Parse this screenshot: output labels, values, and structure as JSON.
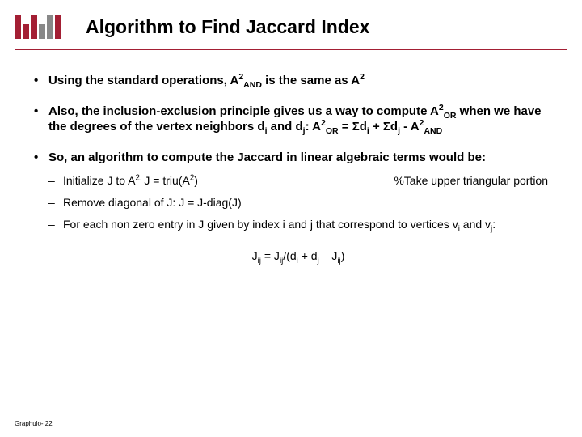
{
  "header": {
    "title": "Algorithm to Find Jaccard Index"
  },
  "bullets": {
    "b1_pre": "Using the standard operations, A",
    "b1_sup1": "2",
    "b1_sub1": "AND",
    "b1_mid": " is the same as A",
    "b1_sup2": "2",
    "b2_pre": "Also, the inclusion-exclusion principle gives us a way to compute A",
    "b2_sup1": "2",
    "b2_sub1": "OR",
    "b2_mid1": " when we have the degrees of the vertex neighbors d",
    "b2_subi": "i",
    "b2_mid2": " and d",
    "b2_subj": "j",
    "b2_mid3": ": A",
    "b2_sup2": "2",
    "b2_sub2": "OR",
    "b2_mid4": " = Σd",
    "b2_subi2": "i",
    "b2_mid5": " + Σd",
    "b2_subj2": "j",
    "b2_mid6": " - A",
    "b2_sup3": "2",
    "b2_sub3": "AND",
    "b3": "So, an algorithm to compute the Jaccard in linear algebraic terms would be:"
  },
  "steps": {
    "s1_pre": "Initialize J to A",
    "s1_sup": "2: ",
    "s1_mid": "J = triu(A",
    "s1_sup2": "2",
    "s1_post": ")",
    "s1_note": "%Take upper triangular portion",
    "s2": "Remove diagonal of J: J = J-diag(J)",
    "s3_pre": "For each non zero entry in J given by index i and j that correspond to vertices v",
    "s3_subi": "i",
    "s3_mid": " and v",
    "s3_subj": "j",
    "s3_post": ":"
  },
  "formula": {
    "pre": "J",
    "sub1": "ij",
    "mid1": " = J",
    "sub2": "ij",
    "mid2": "/(d",
    "sub3": "i",
    "mid3": " + d",
    "sub4": "j",
    "mid4": " – J",
    "sub5": "ij",
    "post": ")"
  },
  "footer": "Graphulo- 22"
}
